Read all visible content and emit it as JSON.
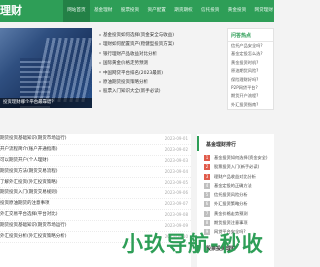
{
  "header": {
    "logo_text": "理财",
    "nav": [
      "网站首页",
      "基金理财",
      "股票投资",
      "资产配置",
      "期货期权",
      "信托投资",
      "黄金投资",
      "网贷理财"
    ]
  },
  "banner": {
    "caption": "投资理财哪个平台最靠谱？"
  },
  "top_list": [
    "基金投资如何选择(资金安全与收益)",
    "理财如何配置资产(稳健型投资方案)",
    "银行理财产品收益对比分析",
    "国际黄金价格走势预测",
    "中国网贷平台排名(2023最新)",
    "原油期货投资策略分析",
    "股票入门知识大全(新手必读)"
  ],
  "side_box": {
    "title": "问答热点",
    "links": [
      "信托产品安全吗?",
      "基金定投怎么选?",
      "黄金投资时机?",
      "原油期货风险?",
      "保险理财好吗?",
      "P2P网贷平台?",
      "期货开户流程?",
      "外汇投资指南?"
    ]
  },
  "main_list": [
    {
      "title": "期货投资基础知识(期货市场运行)",
      "date": "2023-09-01"
    },
    {
      "title": "开户流程简介(账户开通指南)",
      "date": "2023-09-02"
    },
    {
      "title": "可以期货开户(个人理财)",
      "date": "2023-09-03"
    },
    {
      "title": "期货投资方法(期货交易流程)",
      "date": "2023-09-04"
    },
    {
      "title": "了解外汇投资(外汇投资策略)",
      "date": "2023-09-05"
    },
    {
      "title": "期货投资入门(期货交易规则)",
      "date": "2023-09-06"
    },
    {
      "title": "投资原油期货的注意事项",
      "date": "2023-09-07"
    },
    {
      "title": "外汇交易平台选择(平台对比)",
      "date": "2023-09-08"
    },
    {
      "title": "期货投资基础知识(期货市场运行)",
      "date": "2023-09-09"
    },
    {
      "title": "外汇投资分析(外汇投资策略分析)",
      "date": "2023-09-10"
    }
  ],
  "right_panel": {
    "title": "基金理财排行",
    "items": [
      "基金投资如何选择(资金安全)",
      "股票投资入门(新手必读)",
      "理财产品收益对比分析",
      "基金定投的正确方法",
      "信托投资风险分析",
      "外汇投资策略分析",
      "黄金价格走势预测",
      "期货投资注意事项",
      "网贷平台安全吗?"
    ],
    "section2_title": "股票投资理财"
  },
  "watermark": "小玖导航-秒收",
  "colors": {
    "brand": "#2e9e57",
    "hot_badge": "#e05b4b"
  }
}
